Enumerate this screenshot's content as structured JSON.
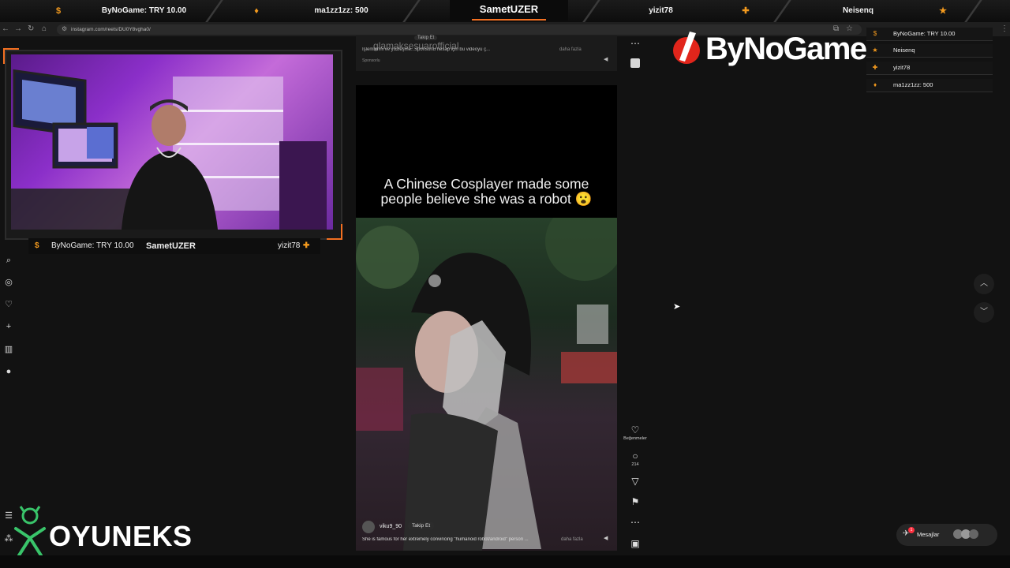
{
  "overlay_top": {
    "segments": [
      {
        "label": "ByNoGame: TRY 10.00",
        "icon": "coin-icon"
      },
      {
        "label": "ma1zz1zz: 500",
        "icon": "flame-icon"
      },
      {
        "label": "yizit78",
        "icon": "plus-icon"
      },
      {
        "label": "Neisenq",
        "icon": "star-icon"
      }
    ],
    "channel": "SametUZER",
    "accent": "#f37021"
  },
  "browser": {
    "url": "instagram.com/reels/DU0Y8vgha0/"
  },
  "webcam": {
    "donation": "ByNoGame: TRY 10.00",
    "channel": "SametUZER",
    "follower": "yizit78"
  },
  "reel_top": {
    "watermark": "glamaksesuarofficial",
    "follow_label": "Takip Et",
    "caption": "İşlemlerini ve yüzleşme...sponsorlu hesap için bu videoyu ç...",
    "more": "daha fazla",
    "sponsored": "Sponsorlu"
  },
  "reel": {
    "title_line1": "A Chinese Cosplayer made some",
    "title_line2": "people believe she was a robot 😮",
    "username": "viku9_90",
    "follow_label": "Takip Et",
    "caption": "She is famous for her extremely convincing \"humanoid robot/android\" person ...",
    "more": "daha fazla"
  },
  "reel_actions": {
    "like_label": "Beğenmeler",
    "comment_count": "214"
  },
  "right_panel": {
    "brand": "ByNoGame",
    "alerts": [
      {
        "text": "ByNoGame: TRY 10.00",
        "icon": "coin-icon"
      },
      {
        "text": "Neisenq",
        "icon": "star-icon"
      },
      {
        "text": "yizit78",
        "icon": "plus-icon"
      },
      {
        "text": "ma1zz1zz: 500",
        "icon": "flame-icon"
      }
    ],
    "messages_label": "Mesajlar",
    "messages_badge": "1"
  },
  "sponsor_logo": "OYUNEKS"
}
